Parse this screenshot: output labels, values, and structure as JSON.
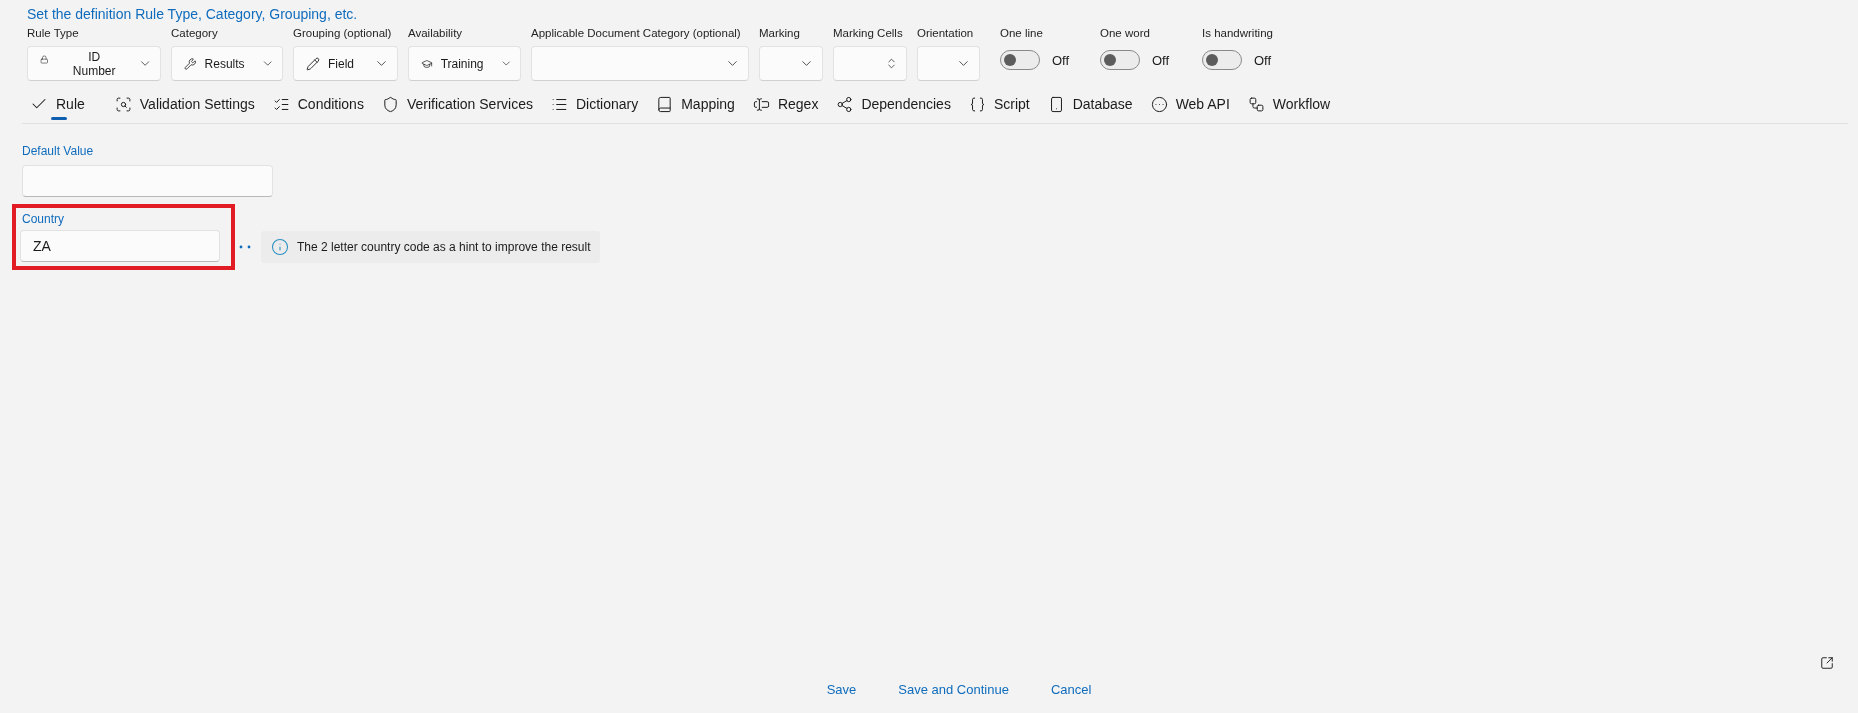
{
  "heading": "Set the definition Rule Type, Category, Grouping, etc.",
  "definition_fields": [
    {
      "kind": "select",
      "label": "Rule Type",
      "value": "ID Number"
    },
    {
      "kind": "select",
      "label": "Category",
      "value": "Results"
    },
    {
      "kind": "select",
      "label": "Grouping (optional)",
      "value": "Field"
    },
    {
      "kind": "select",
      "label": "Availability",
      "value": "Training"
    },
    {
      "kind": "select",
      "label": "Applicable Document Category (optional)"
    },
    {
      "kind": "select",
      "label": "Marking"
    },
    {
      "kind": "spin",
      "label": "Marking Cells"
    },
    {
      "kind": "select",
      "label": "Orientation"
    }
  ],
  "toggles": [
    {
      "label": "One line",
      "on": false,
      "state_text": "Off"
    },
    {
      "label": "One word",
      "on": false,
      "state_text": "Off"
    },
    {
      "label": "Is handwriting",
      "on": false,
      "state_text": "Off"
    }
  ],
  "tabs": [
    {
      "label": "Rule",
      "selected": true
    },
    {
      "label": "Validation Settings",
      "selected": false
    },
    {
      "label": "Conditions",
      "selected": false
    },
    {
      "label": "Verification Services",
      "selected": false
    },
    {
      "label": "Dictionary",
      "selected": false
    },
    {
      "label": "Mapping",
      "selected": false
    },
    {
      "label": "Regex",
      "selected": false
    },
    {
      "label": "Dependencies",
      "selected": false
    },
    {
      "label": "Script",
      "selected": false
    },
    {
      "label": "Database",
      "selected": false
    },
    {
      "label": "Web API",
      "selected": false
    },
    {
      "label": "Workflow",
      "selected": false
    }
  ],
  "default_value": {
    "label": "Default Value"
  },
  "country": {
    "label": "Country",
    "value": "ZA",
    "hint": "The 2 letter country code as a hint to improve the result"
  },
  "buttons": [
    "Save",
    "Save and Continue",
    "Cancel"
  ]
}
